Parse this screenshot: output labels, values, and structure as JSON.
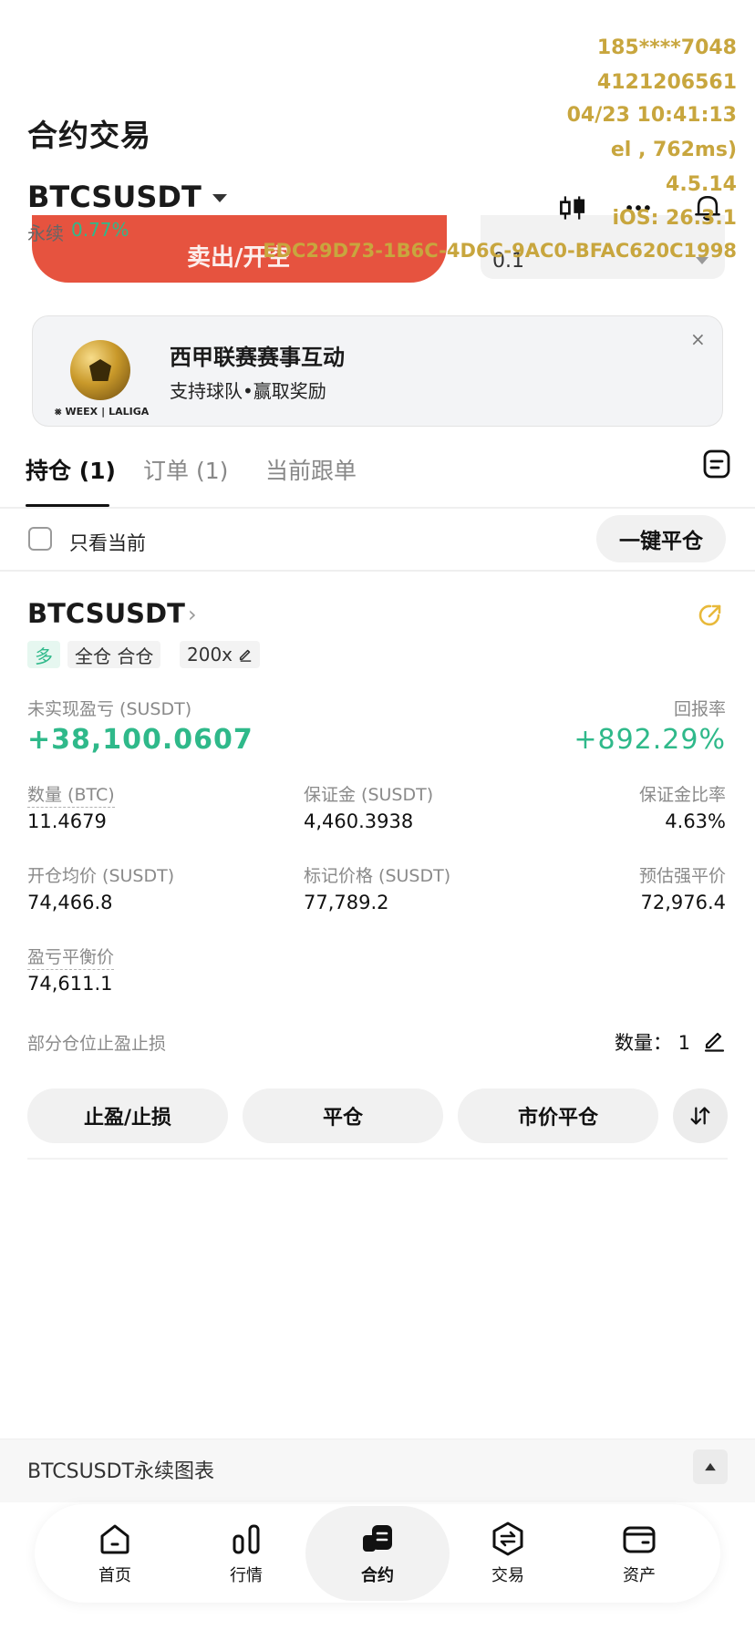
{
  "header": {
    "title": "合约交易",
    "symbol": "BTCSUSDT",
    "perp_label": "永续",
    "change": "0.77%"
  },
  "peek": {
    "sell_label": "卖出/开空",
    "qty_value": "0.1"
  },
  "watermark": {
    "line1": "185****7048",
    "line2": "4121206561",
    "line3": "04/23 10:41:13",
    "line4": "el , 762ms)",
    "line5": "4.5.14",
    "line6": "iOS:  26.3.1",
    "line7": "EDC29D73-1B6C-4D6C-9AC0-BFAC620C1998"
  },
  "banner": {
    "title": "西甲联赛赛事互动",
    "subtitle": "支持球队•赢取奖励",
    "brand": "WEEX",
    "partner": "LALIGA",
    "close": "×"
  },
  "tabs": [
    {
      "label": "持仓 (1)"
    },
    {
      "label": "订单 (1)"
    },
    {
      "label": "当前跟单"
    }
  ],
  "filter": {
    "only_current": "只看当前",
    "close_all": "一键平仓"
  },
  "position": {
    "symbol": "BTCSUSDT",
    "side": "多",
    "margin_mode": "全仓 合仓",
    "leverage": "200x",
    "pnl_label": "未实现盈亏 (SUSDT)",
    "pnl_value": "+38,100.0607",
    "roe_label": "回报率",
    "roe_value": "+892.29%",
    "qty_label": "数量 (BTC)",
    "qty_value": "11.4679",
    "margin_label": "保证金 (SUSDT)",
    "margin_value": "4,460.3938",
    "margin_ratio_label": "保证金比率",
    "margin_ratio_value": "4.63%",
    "entry_label": "开仓均价 (SUSDT)",
    "entry_value": "74,466.8",
    "mark_label": "标记价格 (SUSDT)",
    "mark_value": "77,789.2",
    "liq_label": "预估强平价",
    "liq_value": "72,976.4",
    "breakeven_label": "盈亏平衡价",
    "breakeven_value": "74,611.1",
    "partial_label": "部分仓位止盈止损",
    "partial_qty": "数量：  1",
    "actions": [
      "止盈/止损",
      "平仓",
      "市价平仓"
    ]
  },
  "chart_bar": {
    "label": "BTCSUSDT永续图表"
  },
  "nav": [
    {
      "label": "首页",
      "icon": "home-icon"
    },
    {
      "label": "行情",
      "icon": "markets-icon"
    },
    {
      "label": "合约",
      "icon": "futures-icon"
    },
    {
      "label": "交易",
      "icon": "trade-icon"
    },
    {
      "label": "资产",
      "icon": "wallet-icon"
    }
  ],
  "colors": {
    "accent_green": "#2fb98a",
    "sell_red": "#e6533f",
    "watermark_gold": "#c8a63e"
  }
}
